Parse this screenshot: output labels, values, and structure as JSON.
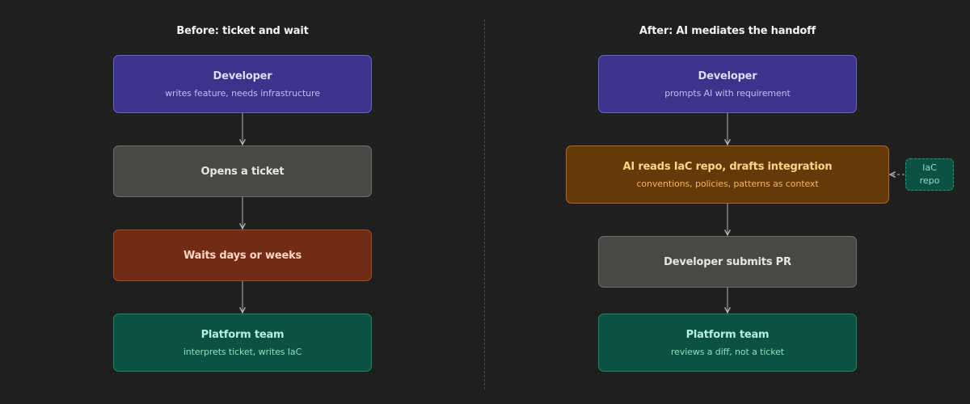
{
  "before": {
    "title": "Before: ticket and wait",
    "steps": [
      {
        "title": "Developer",
        "subtitle": "writes feature, needs infrastructure"
      },
      {
        "title": "Opens a ticket"
      },
      {
        "title": "Waits days or weeks"
      },
      {
        "title": "Platform team",
        "subtitle": "interprets ticket, writes IaC"
      }
    ]
  },
  "after": {
    "title": "After: AI mediates the handoff",
    "steps": [
      {
        "title": "Developer",
        "subtitle": "prompts AI with requirement"
      },
      {
        "title": "AI reads IaC repo, drafts integration",
        "subtitle": "conventions, policies, patterns as context"
      },
      {
        "title": "Developer submits PR"
      },
      {
        "title": "Platform team",
        "subtitle": "reviews a diff, not a ticket"
      }
    ],
    "repo_note": {
      "line1": "IaC",
      "line2": "repo"
    }
  },
  "colors": {
    "background": "#1f1f1f",
    "developer": "#3c348a",
    "neutral": "#484845",
    "waiting": "#732c14",
    "platform": "#0b5243",
    "ai": "#643a09"
  }
}
